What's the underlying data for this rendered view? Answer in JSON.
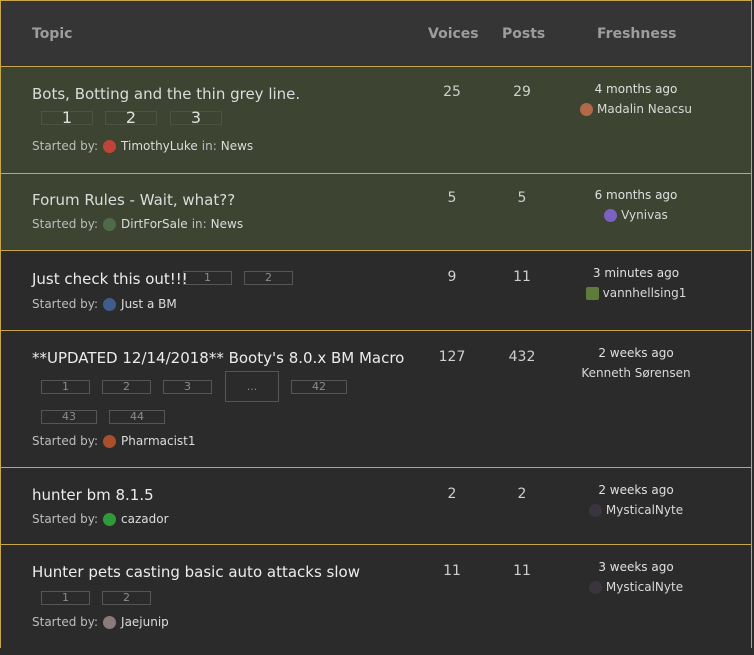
{
  "header": {
    "topic": "Topic",
    "voices": "Voices",
    "posts": "Posts",
    "freshness": "Freshness"
  },
  "labels": {
    "started_by": "Started by:",
    "in": "in:"
  },
  "topics": [
    {
      "title": "Bots, Botting and the thin grey line.",
      "voices": "25",
      "posts": "29",
      "pages": [
        "1",
        "2",
        "3"
      ],
      "author": "TimothyLuke",
      "forum": "News",
      "fresh_ago": "4 months ago",
      "fresh_by": "Madalin Neacsu"
    },
    {
      "title": "Forum Rules - Wait, what??",
      "voices": "5",
      "posts": "5",
      "author": "DirtForSale",
      "forum": "News",
      "fresh_ago": "6 months ago",
      "fresh_by": "Vynivas"
    },
    {
      "title": "Just check this out!!!",
      "voices": "9",
      "posts": "11",
      "pages": [
        "1",
        "2"
      ],
      "author": "Just a BM",
      "fresh_ago": "3 minutes ago",
      "fresh_by": "vannhellsing1"
    },
    {
      "title": "**UPDATED 12/14/2018** Booty's 8.0.x BM Macro",
      "voices": "127",
      "posts": "432",
      "pages": [
        "1",
        "2",
        "3",
        "...",
        "42",
        "43",
        "44"
      ],
      "author": "Pharmacist1",
      "fresh_ago": "2 weeks ago",
      "fresh_by": "Kenneth Sørensen"
    },
    {
      "title": "hunter bm 8.1.5",
      "voices": "2",
      "posts": "2",
      "author": "cazador",
      "fresh_ago": "2 weeks ago",
      "fresh_by": "MysticalNyte"
    },
    {
      "title": "Hunter pets casting basic auto attacks slow",
      "voices": "11",
      "posts": "11",
      "pages": [
        "1",
        "2"
      ],
      "author": "Jaejunip",
      "fresh_ago": "3 weeks ago",
      "fresh_by": "MysticalNyte"
    }
  ]
}
